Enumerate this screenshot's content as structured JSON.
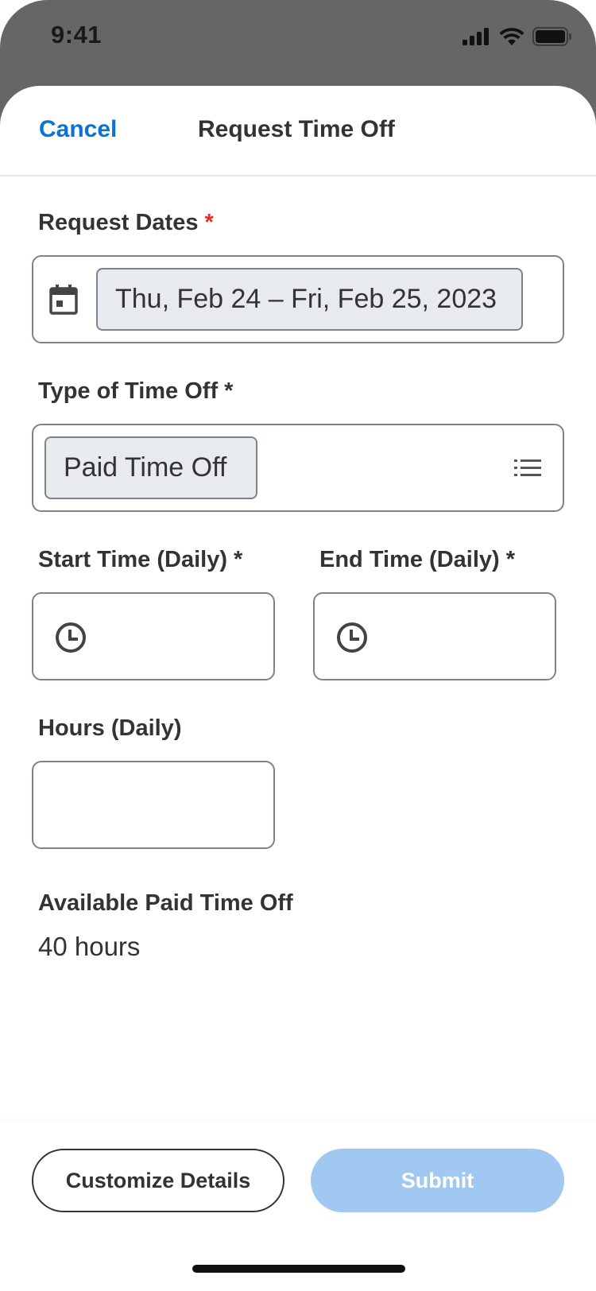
{
  "status_bar": {
    "time": "9:41"
  },
  "nav": {
    "cancel_label": "Cancel",
    "title": "Request Time Off"
  },
  "request_dates": {
    "label": "Request Dates",
    "required_mark": "*",
    "value": "Thu, Feb 24 – Fri, Feb 25, 2023",
    "icon": "calendar-icon"
  },
  "time_off_type": {
    "label": "Type of Time Off",
    "required_mark": "*",
    "value": "Paid Time Off",
    "icon": "list-icon"
  },
  "start_time": {
    "label": "Start Time (Daily)",
    "required_mark": "*",
    "value": "",
    "icon": "clock-icon"
  },
  "end_time": {
    "label": "End Time (Daily)",
    "required_mark": "*",
    "value": "",
    "icon": "clock-icon"
  },
  "hours": {
    "label": "Hours (Daily)",
    "value": ""
  },
  "available": {
    "label": "Available Paid Time Off",
    "value": "40 hours"
  },
  "footer": {
    "customize_label": "Customize Details",
    "submit_label": "Submit",
    "submit_enabled": false
  },
  "colors": {
    "accent": "#0b72d6",
    "required": "#de2e21",
    "submit_disabled": "#a0c8f0",
    "pill_background": "#e8ebee"
  }
}
